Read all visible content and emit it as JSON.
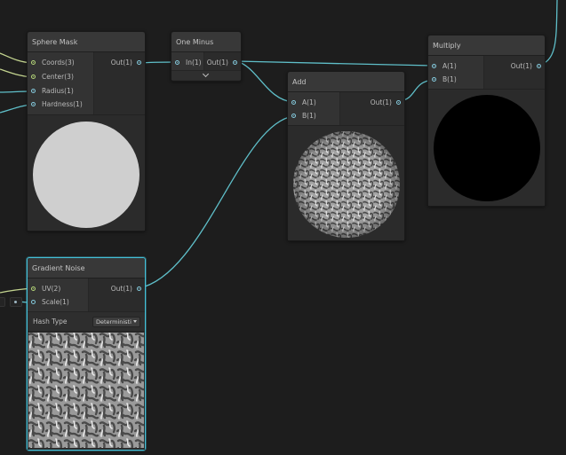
{
  "colors": {
    "background": "#1d1d1d",
    "wire_blue": "#5fbfc9",
    "wire_yellow": "#c3d48f",
    "node_body": "#2b2b2b",
    "node_header": "#383838",
    "selected_border": "#44c0d8"
  },
  "nodes": {
    "sphere_mask": {
      "title": "Sphere Mask",
      "inputs": [
        "Coords(3)",
        "Center(3)",
        "Radius(1)",
        "Hardness(1)"
      ],
      "output": "Out(1)"
    },
    "one_minus": {
      "title": "One Minus",
      "input": "In(1)",
      "output": "Out(1)"
    },
    "add": {
      "title": "Add",
      "inputs": [
        "A(1)",
        "B(1)"
      ],
      "output": "Out(1)"
    },
    "multiply": {
      "title": "Multiply",
      "inputs": [
        "A(1)",
        "B(1)"
      ],
      "output": "Out(1)"
    },
    "gradient_noise": {
      "title": "Gradient Noise",
      "inputs": [
        "UV(2)",
        "Scale(1)"
      ],
      "output": "Out(1)",
      "hash_type_label": "Hash Type",
      "hash_type_value": "Deterministic"
    }
  },
  "icons": {
    "collapse": "chevron-down-icon",
    "dropdown": "caret-down-icon"
  }
}
